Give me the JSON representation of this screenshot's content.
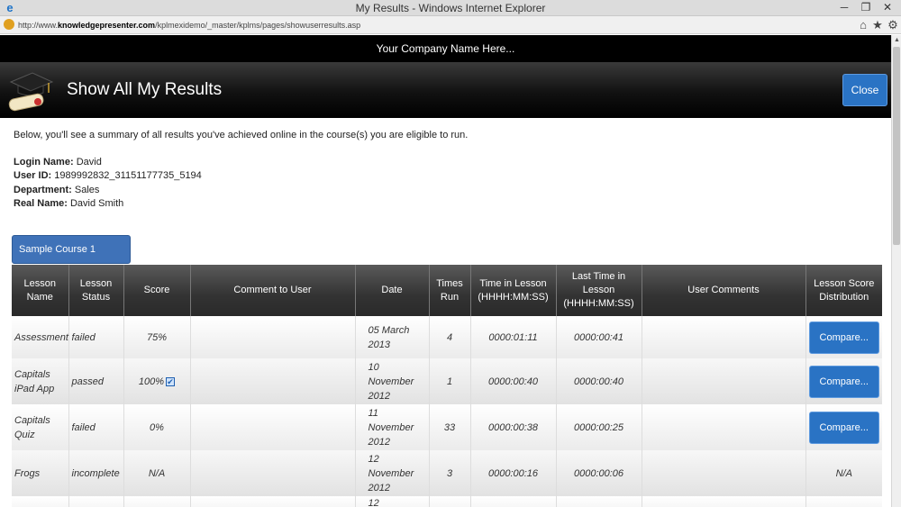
{
  "window": {
    "title": "My Results - Windows Internet Explorer",
    "url_prefix": "http://www.",
    "url_domain": "knowledgepresenter.com",
    "url_path": "/kplmexidemo/_master/kplms/pages/showuserresults.asp",
    "minimize_glyph": "─",
    "maximize_glyph": "❐",
    "close_glyph": "✕",
    "home_glyph": "⌂",
    "favorites_glyph": "★",
    "tools_glyph": "⚙"
  },
  "company_name": "Your Company Name Here...",
  "page": {
    "title": "Show All My Results",
    "close_label": "Close"
  },
  "intro": "Below, you'll see a summary of all results you've achieved online in the course(s) you are eligible to run.",
  "user": [
    {
      "label": "Login Name:",
      "value": "David"
    },
    {
      "label": "User ID:",
      "value": "1989992832_31151177735_5194"
    },
    {
      "label": "Department:",
      "value": "Sales"
    },
    {
      "label": "Real Name:",
      "value": "David Smith"
    }
  ],
  "course": {
    "name": "Sample Course 1"
  },
  "table": {
    "headers": [
      "Lesson Name",
      "Lesson Status",
      "Score",
      "Comment to User",
      "Date",
      "Times Run",
      "Time in Lesson (HHHH:MM:SS)",
      "Last Time in Lesson (HHHH:MM:SS)",
      "User Comments",
      "Lesson Score Distribution"
    ],
    "rows": [
      {
        "name": "Assessment",
        "status": "failed",
        "score": "75%",
        "check": "",
        "comment": "",
        "date": "05 March 2013",
        "times": "4",
        "time_in": "0000:01:11",
        "last_time": "0000:00:41",
        "user_comments": "",
        "distribution": "Compare...",
        "dist_type": "button"
      },
      {
        "name": "Capitals iPad App",
        "status": "passed",
        "score": "100%",
        "check": "✔",
        "comment": "",
        "date": "10 November 2012",
        "times": "1",
        "time_in": "0000:00:40",
        "last_time": "0000:00:40",
        "user_comments": "",
        "distribution": "Compare...",
        "dist_type": "button"
      },
      {
        "name": "Capitals Quiz",
        "status": "failed",
        "score": "0%",
        "check": "",
        "comment": "",
        "date": "11 November 2012",
        "times": "33",
        "time_in": "0000:00:38",
        "last_time": "0000:00:25",
        "user_comments": "",
        "distribution": "Compare...",
        "dist_type": "button"
      },
      {
        "name": "Frogs",
        "status": "incomplete",
        "score": "N/A",
        "check": "",
        "comment": "",
        "date": "12 November 2012",
        "times": "3",
        "time_in": "0000:00:16",
        "last_time": "0000:00:06",
        "user_comments": "",
        "distribution": "N/A",
        "dist_type": "text"
      },
      {
        "name": "",
        "status": "",
        "score": "",
        "check": "",
        "comment": "",
        "date": "12",
        "times": "",
        "time_in": "",
        "last_time": "",
        "user_comments": "",
        "distribution": "",
        "dist_type": "text"
      }
    ]
  }
}
